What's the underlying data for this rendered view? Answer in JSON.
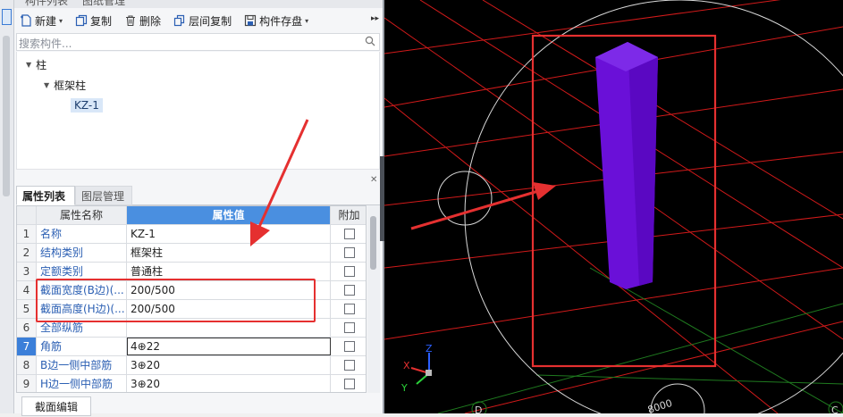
{
  "panel_tabs": {
    "component_list": "构件列表",
    "drawing_manage": "图纸管理"
  },
  "toolbar": {
    "new_label": "新建",
    "copy_label": "复制",
    "delete_label": "删除",
    "floor_copy_label": "层间复制",
    "save_label": "构件存盘"
  },
  "search": {
    "placeholder": "搜索构件..."
  },
  "tree": {
    "root": "柱",
    "child": "框架柱",
    "leaf": "KZ-1"
  },
  "attr_tabs": {
    "properties": "属性列表",
    "layers": "图层管理"
  },
  "grid": {
    "headers": {
      "name": "属性名称",
      "value": "属性值",
      "extra": "附加"
    },
    "rows": [
      {
        "no": "1",
        "name": "名称",
        "value": "KZ-1"
      },
      {
        "no": "2",
        "name": "结构类别",
        "value": "框架柱"
      },
      {
        "no": "3",
        "name": "定额类别",
        "value": "普通柱"
      },
      {
        "no": "4",
        "name": "截面宽度(B边)(...",
        "value": "200/500"
      },
      {
        "no": "5",
        "name": "截面高度(H边)(...",
        "value": "200/500"
      },
      {
        "no": "6",
        "name": "全部纵筋",
        "value": ""
      },
      {
        "no": "7",
        "name": "角筋",
        "value": "4⊕22"
      },
      {
        "no": "8",
        "name": "B边一侧中部筋",
        "value": "3⊕20"
      },
      {
        "no": "9",
        "name": "H边一侧中部筋",
        "value": "3⊕20"
      }
    ]
  },
  "bottom": {
    "section_edit_label": "截面编辑"
  },
  "viewport": {
    "axis_x": "X",
    "axis_y": "Y",
    "axis_z": "Z",
    "axis_label_d": "D",
    "axis_label_c": "C",
    "dim_text": "8000"
  },
  "colors": {
    "column": "#6a10d8",
    "annotation_red": "#e53030",
    "grid_red": "#d21a1a",
    "grid_green": "#1f7a1f"
  }
}
